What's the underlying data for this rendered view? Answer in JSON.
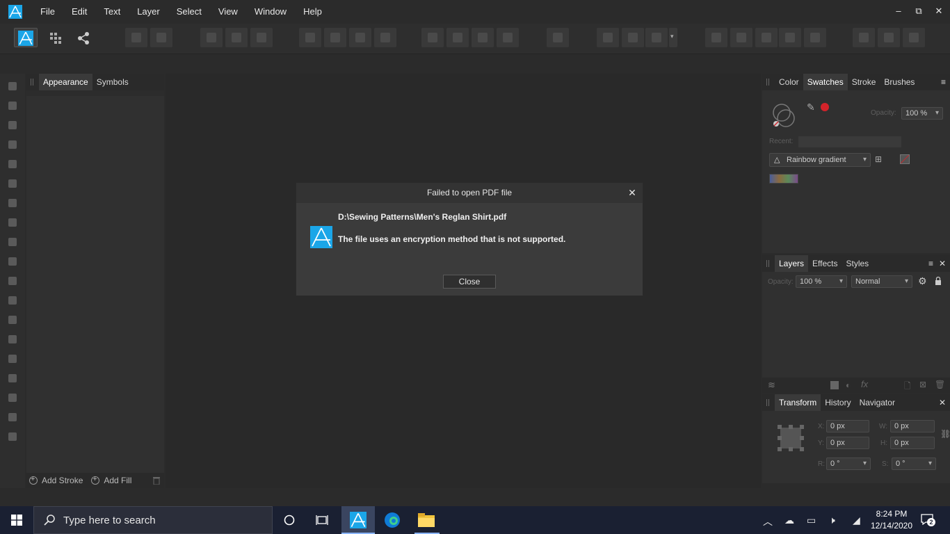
{
  "menu": {
    "items": [
      "File",
      "Edit",
      "Text",
      "Layer",
      "Select",
      "View",
      "Window",
      "Help"
    ]
  },
  "window_controls": {
    "minimize": "–",
    "restore": "⧉",
    "close": "✕"
  },
  "left_panel": {
    "tabs": [
      "Appearance",
      "Symbols"
    ],
    "footer": {
      "add_stroke": "Add Stroke",
      "add_fill": "Add Fill"
    }
  },
  "swatches_panel": {
    "tabs": [
      "Color",
      "Swatches",
      "Stroke",
      "Brushes"
    ],
    "opacity_label": "Opacity:",
    "opacity_value": "100 %",
    "recent_label": "Recent:",
    "palette_name": "Rainbow gradient"
  },
  "layers_panel": {
    "tabs": [
      "Layers",
      "Effects",
      "Styles"
    ],
    "opacity_label": "Opacity:",
    "opacity_value": "100 %",
    "blend_mode": "Normal"
  },
  "transform_panel": {
    "tabs": [
      "Transform",
      "History",
      "Navigator"
    ],
    "x_label": "X:",
    "x_value": "0 px",
    "y_label": "Y:",
    "y_value": "0 px",
    "w_label": "W:",
    "w_value": "0 px",
    "h_label": "H:",
    "h_value": "0 px",
    "r_label": "R:",
    "r_value": "0 °",
    "s_label": "S:",
    "s_value": "0 °"
  },
  "dialog": {
    "title": "Failed to open PDF file",
    "file_path": "D:\\Sewing Patterns\\Men's Reglan Shirt.pdf",
    "message": "The file uses an encryption method that is not supported.",
    "close_button": "Close"
  },
  "taskbar": {
    "search_placeholder": "Type here to search",
    "time": "8:24 PM",
    "date": "12/14/2020",
    "notification_count": "2"
  },
  "colors": {
    "accent": "#1ba6e8",
    "swatch_red": "#d3232a",
    "taskbar_bg": "#1a2032"
  }
}
